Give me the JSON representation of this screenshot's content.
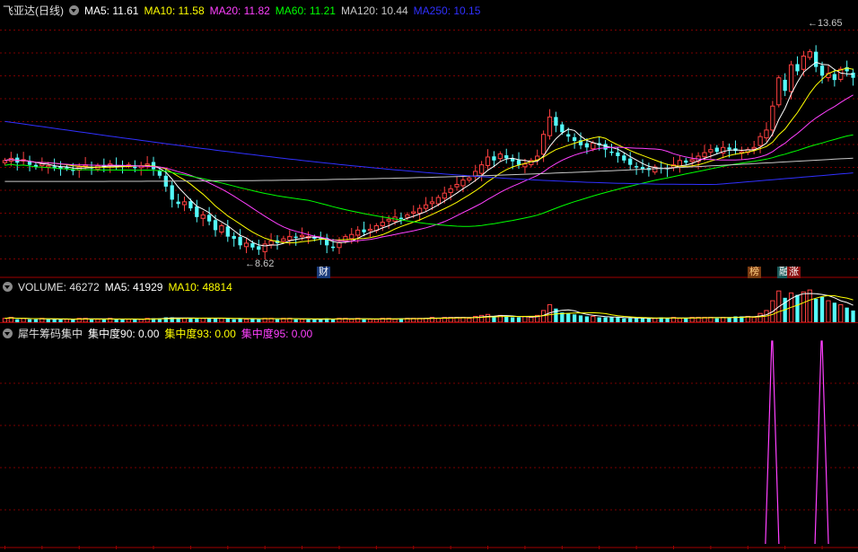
{
  "price_legend": {
    "stock_name": "飞亚达(日线)",
    "ma5": "MA5: 11.61",
    "ma10": "MA10: 11.58",
    "ma20": "MA20: 11.82",
    "ma60": "MA60: 11.21",
    "ma120": "MA120: 10.44",
    "ma250": "MA250: 10.15"
  },
  "volume_legend": {
    "volume": "VOLUME: 46272",
    "ma5": "MA5: 41929",
    "ma10": "MA10: 48814"
  },
  "chip_legend": {
    "name": "犀牛筹码集中",
    "c90": "集中度90: 0.00",
    "c93": "集中度93: 0.00",
    "c95": "集中度95: 0.00"
  },
  "annotations": {
    "high": "13.65",
    "low": "8.62"
  },
  "event_tags": [
    "财",
    "榜",
    "融",
    "涨"
  ],
  "colors": {
    "up": "#ff4040",
    "down": "#54fcfc",
    "ma5": "#ffffff",
    "ma10": "#ffff00",
    "ma20": "#ff40ff",
    "ma60": "#00ff00",
    "ma120": "#c8c8c8",
    "ma250": "#3030ff",
    "grid": "#7a0000",
    "chip": "#ff40ff"
  },
  "chart_data": [
    {
      "type": "candlestick",
      "title": "飞亚达(日线)",
      "ylim": [
        8.2,
        14.1
      ],
      "high_label": 13.65,
      "low_label": 8.62,
      "closes": [
        10.7,
        10.75,
        10.65,
        10.72,
        10.6,
        10.55,
        10.62,
        10.58,
        10.55,
        10.5,
        10.52,
        10.48,
        10.55,
        10.6,
        10.52,
        10.58,
        10.55,
        10.62,
        10.58,
        10.55,
        10.6,
        10.55,
        10.58,
        10.62,
        10.5,
        10.35,
        10.1,
        9.8,
        9.7,
        9.75,
        9.6,
        9.4,
        9.45,
        9.3,
        9.1,
        9.2,
        8.95,
        8.9,
        8.75,
        8.8,
        8.7,
        8.65,
        8.78,
        8.85,
        8.8,
        8.9,
        8.95,
        8.92,
        8.98,
        8.95,
        8.9,
        8.88,
        8.75,
        8.7,
        8.82,
        8.95,
        9.0,
        9.1,
        9.05,
        9.12,
        9.2,
        9.28,
        9.35,
        9.4,
        9.38,
        9.45,
        9.52,
        9.6,
        9.68,
        9.75,
        9.85,
        9.95,
        10.05,
        10.15,
        10.25,
        10.3,
        10.45,
        10.6,
        10.78,
        10.7,
        10.85,
        10.75,
        10.68,
        10.6,
        10.62,
        10.7,
        10.8,
        11.3,
        11.7,
        11.5,
        11.35,
        11.25,
        11.15,
        11.05,
        11.0,
        11.1,
        11.05,
        10.95,
        10.9,
        10.8,
        10.7,
        10.6,
        10.55,
        10.5,
        10.48,
        10.55,
        10.52,
        10.5,
        10.6,
        10.7,
        10.65,
        10.72,
        10.8,
        10.88,
        10.95,
        10.9,
        11.0,
        10.95,
        10.92,
        10.9,
        10.95,
        11.0,
        11.25,
        11.4,
        11.95,
        12.6,
        12.3,
        12.9,
        12.75,
        13.1,
        13.2,
        12.85,
        12.65,
        12.7,
        12.55,
        12.8,
        12.75,
        12.6
      ],
      "moving_averages": [
        "MA5",
        "MA10",
        "MA20",
        "MA60",
        "MA120",
        "MA250"
      ]
    },
    {
      "type": "bar",
      "title": "VOLUME",
      "values": [
        4,
        5,
        3,
        4,
        3,
        3,
        4,
        3,
        3,
        3,
        3,
        3,
        4,
        4,
        3,
        3,
        3,
        4,
        3,
        3,
        3,
        3,
        3,
        4,
        4,
        4,
        5,
        5,
        4,
        4,
        4,
        4,
        4,
        4,
        4,
        4,
        4,
        3,
        4,
        3,
        4,
        3,
        4,
        4,
        3,
        4,
        4,
        3,
        3,
        3,
        3,
        3,
        4,
        3,
        4,
        4,
        3,
        4,
        3,
        3,
        3,
        4,
        4,
        3,
        4,
        4,
        4,
        4,
        4,
        5,
        4,
        5,
        5,
        5,
        5,
        4,
        6,
        7,
        8,
        6,
        7,
        6,
        5,
        5,
        6,
        5,
        7,
        12,
        18,
        14,
        10,
        9,
        8,
        7,
        6,
        6,
        5,
        5,
        5,
        5,
        4,
        4,
        4,
        4,
        4,
        4,
        5,
        4,
        5,
        4,
        4,
        5,
        5,
        5,
        5,
        4,
        5,
        5,
        6,
        6,
        6,
        5,
        9,
        12,
        22,
        32,
        25,
        30,
        28,
        31,
        33,
        24,
        26,
        22,
        20,
        18,
        15,
        12
      ]
    },
    {
      "type": "line",
      "title": "犀牛筹码集中",
      "series_name": "集中度95",
      "spikes": [
        124,
        132
      ],
      "ylim": [
        0,
        1
      ]
    }
  ]
}
